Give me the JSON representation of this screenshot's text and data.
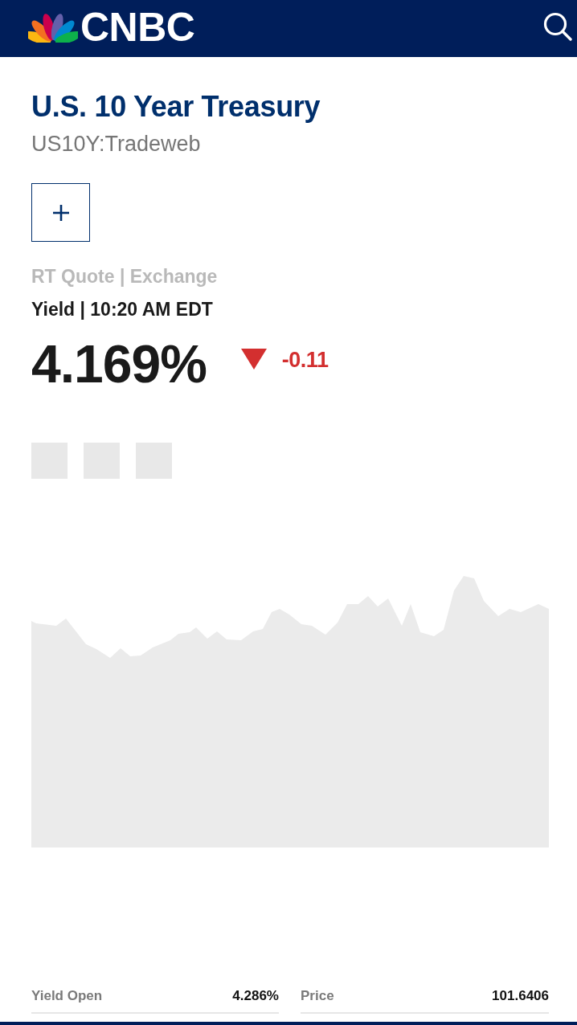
{
  "header": {
    "logo_text": "CNBC"
  },
  "quote": {
    "title": "U.S. 10 Year Treasury",
    "symbol": "US10Y:Tradeweb",
    "source": "RT Quote | Exchange",
    "timestamp": "Yield | 10:20 AM EDT",
    "last": "4.169%",
    "change": {
      "value": "-0.11",
      "down": true
    }
  },
  "stats": [
    {
      "label": "Yield Open",
      "value": "4.286%"
    },
    {
      "label": "Price",
      "value": "101.6406"
    }
  ]
}
